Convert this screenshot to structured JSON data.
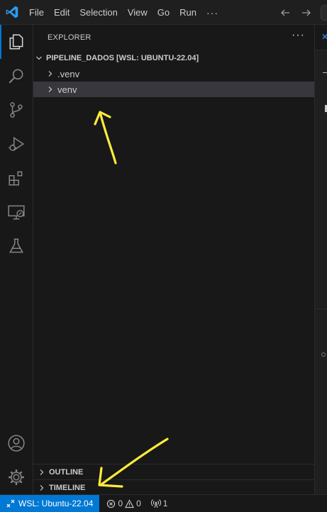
{
  "titlebar": {
    "menu": [
      "File",
      "Edit",
      "Selection",
      "View",
      "Go",
      "Run"
    ],
    "more": "···"
  },
  "sidebar": {
    "title": "EXPLORER",
    "more_actions": "···",
    "root_folder": "PIPELINE_DADOS [WSL: UBUNTU-22.04]",
    "items": [
      {
        "label": ".venv",
        "expanded": false,
        "selected": false
      },
      {
        "label": "venv",
        "expanded": false,
        "selected": true
      }
    ],
    "sections": [
      "OUTLINE",
      "TIMELINE"
    ]
  },
  "activitybar": {
    "top": [
      "explorer-icon",
      "search-icon",
      "source-control-icon",
      "run-debug-icon",
      "extensions-icon",
      "remote-explorer-icon",
      "testing-icon"
    ],
    "bottom": [
      "accounts-icon",
      "manage-gear-icon"
    ]
  },
  "statusbar": {
    "remote": "WSL: Ubuntu-22.04",
    "errors": "0",
    "warnings": "0",
    "ports": "1"
  },
  "colors": {
    "accent": "#0078d4",
    "background": "#181818",
    "selection": "#37373d",
    "annotation": "#ffeb3b"
  }
}
